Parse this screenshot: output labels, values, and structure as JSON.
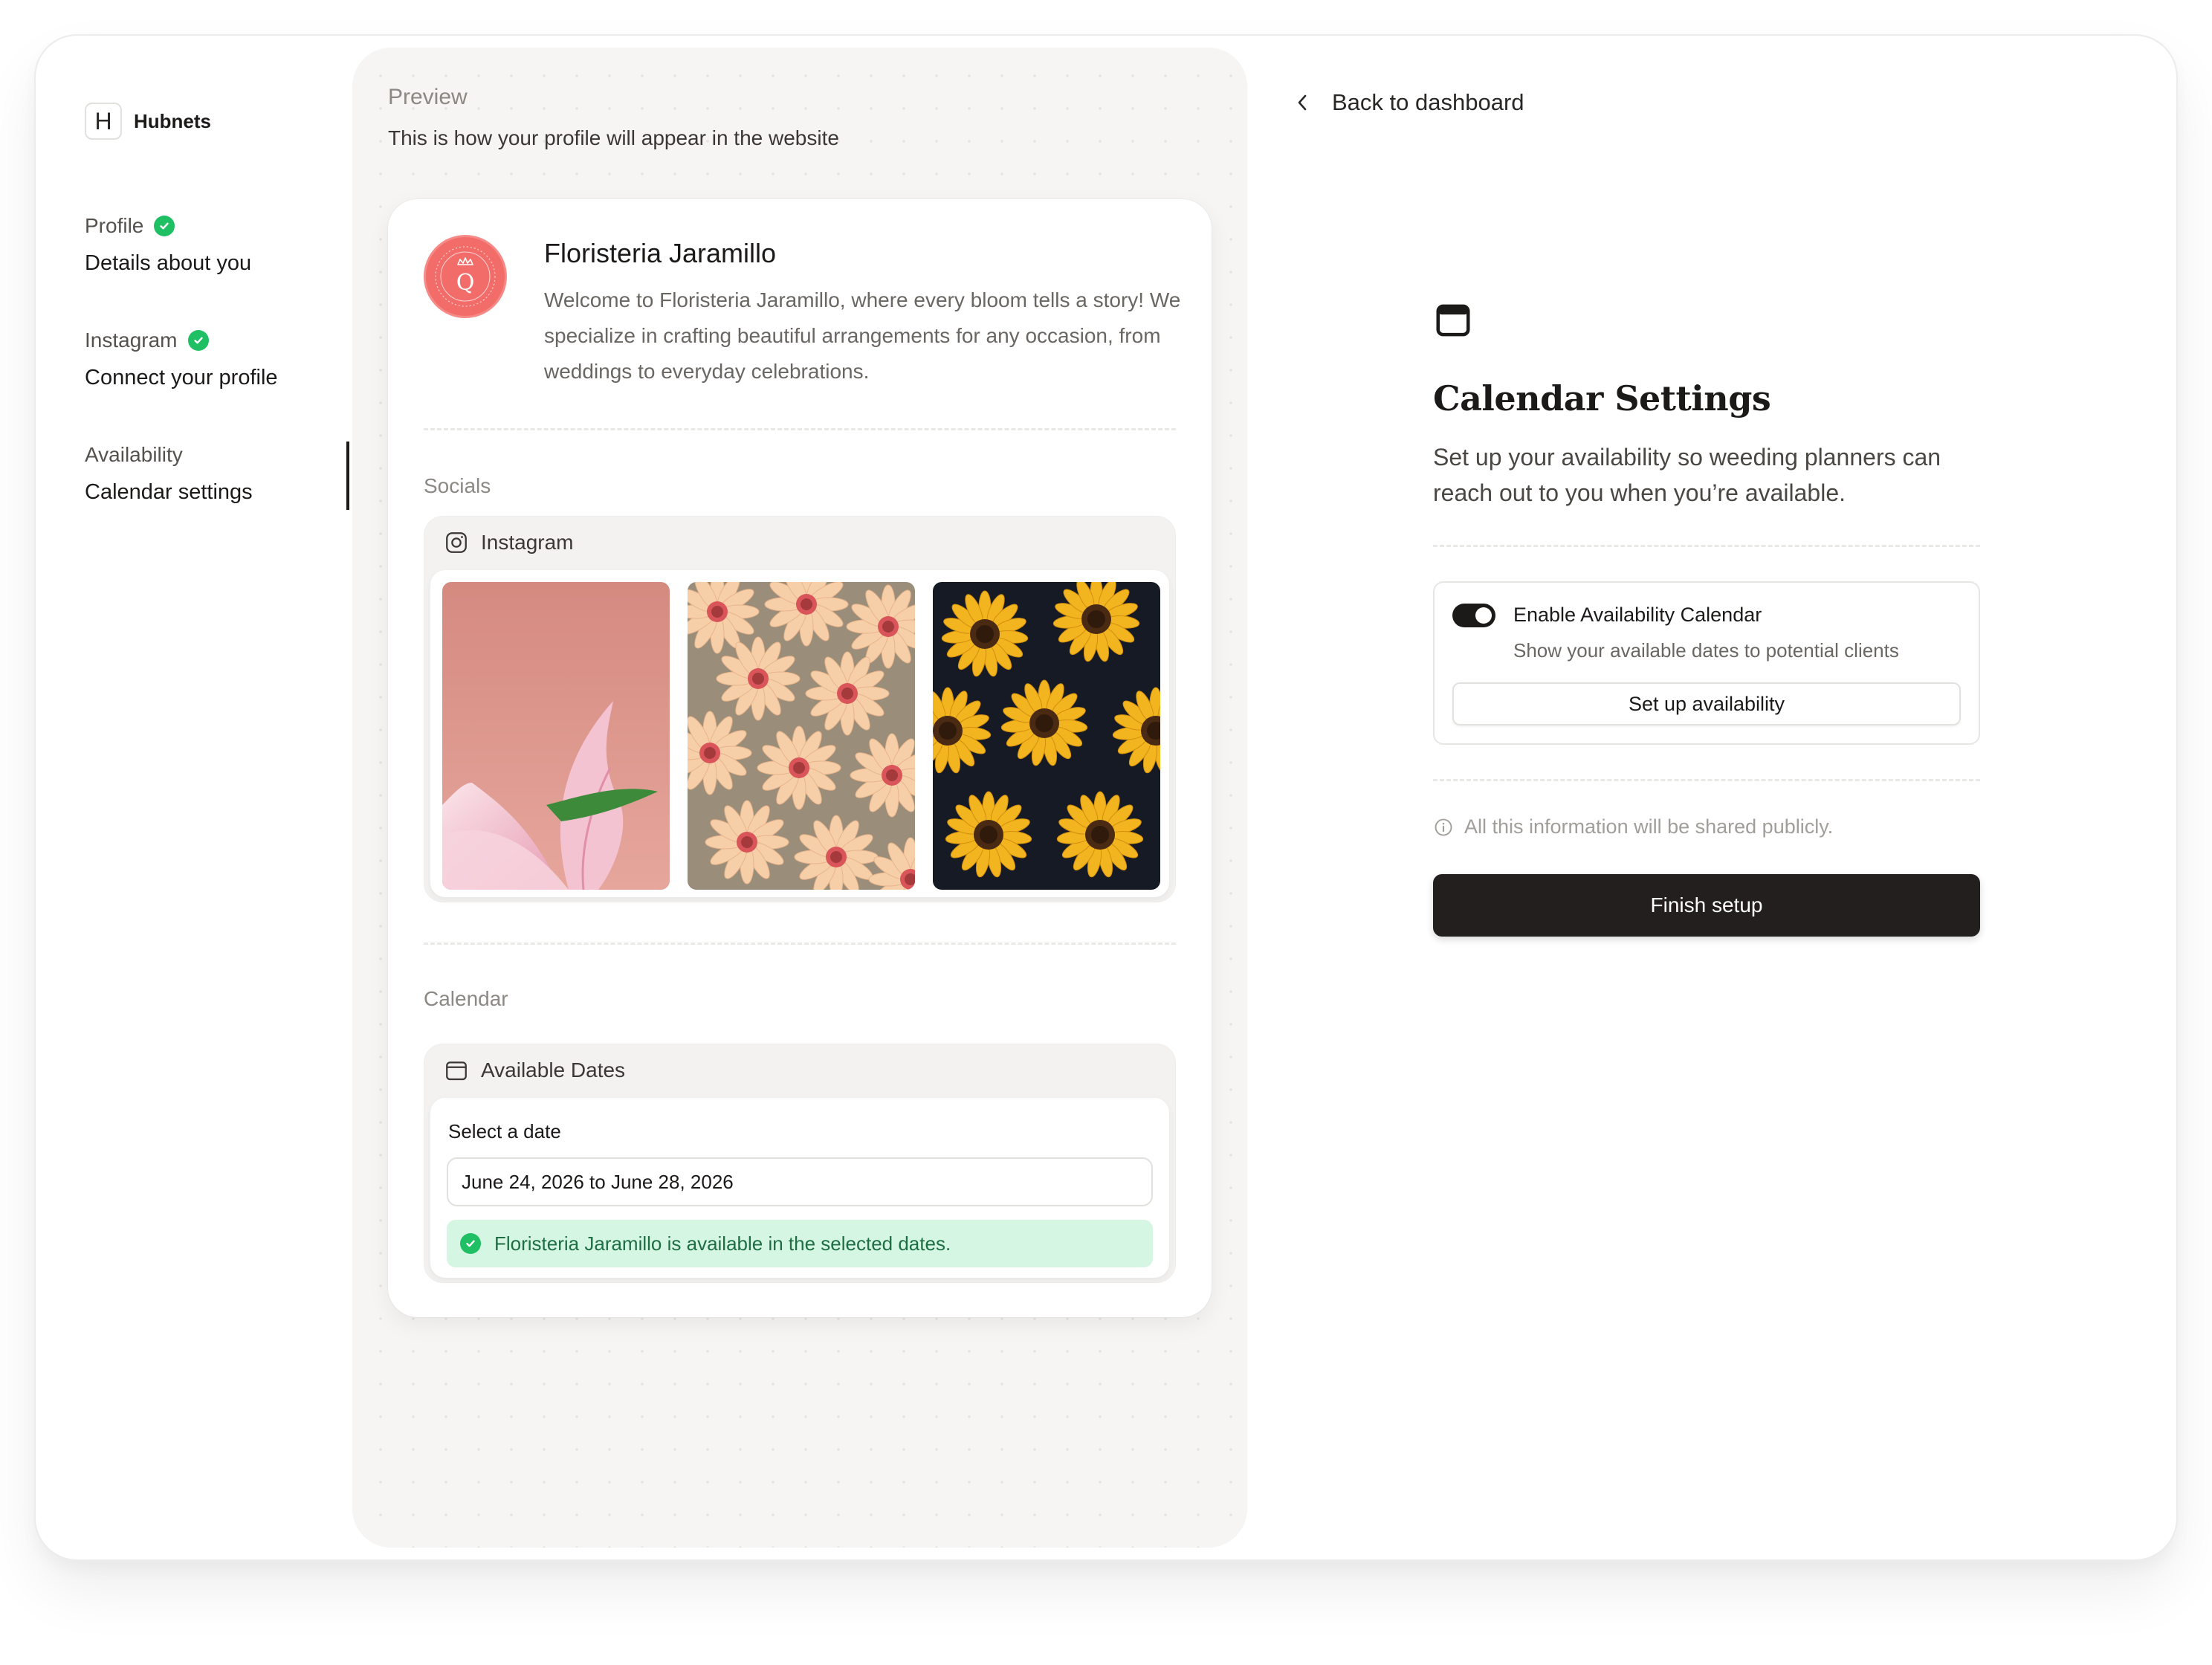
{
  "brand": {
    "mark": "H",
    "name": "Hubnets"
  },
  "steps": [
    {
      "title": "Profile",
      "subtitle": "Details about you",
      "completed": true
    },
    {
      "title": "Instagram",
      "subtitle": "Connect your profile",
      "completed": true
    },
    {
      "title": "Availability",
      "subtitle": "Calendar settings",
      "completed": false,
      "active": true
    }
  ],
  "preview": {
    "title": "Preview",
    "subtitle": "This is how your profile will appear in the website",
    "profile": {
      "logo_letter": "Q",
      "name": "Floristeria Jaramillo",
      "description": "Welcome to Floristeria Jaramillo, where every bloom tells a story! We specialize in crafting beautiful arrangements for any occasion, from weddings to everyday celebrations."
    },
    "socials": {
      "label": "Socials",
      "instagram_label": "Instagram",
      "photos": [
        "pink-lily-photo",
        "peach-daisies-photo",
        "yellow-sunflowers-photo"
      ]
    },
    "calendar": {
      "label": "Calendar",
      "card_title": "Available Dates",
      "field_label": "Select a date",
      "date_value": "June 24, 2026 to June 28, 2026",
      "availability_message": "Floristeria Jaramillo is available in the selected dates."
    }
  },
  "nav": {
    "back_label": "Back to dashboard"
  },
  "settings": {
    "icon": "calendar-icon",
    "title": "Calendar Settings",
    "description": "Set up your availability so weeding planners can reach out to you when you’re available.",
    "toggle": {
      "enabled": true,
      "title": "Enable Availability Calendar",
      "subtitle": "Show your available dates to potential clients"
    },
    "setup_button": "Set up availability",
    "public_note": "All this information will be shared publicly.",
    "finish_button": "Finish setup"
  },
  "colors": {
    "accent_dark": "#221f1e",
    "success": "#1fbf63",
    "success_bg": "#d5f6e3",
    "logo": "#f26d6a",
    "panel_bg": "#f6f5f3"
  }
}
